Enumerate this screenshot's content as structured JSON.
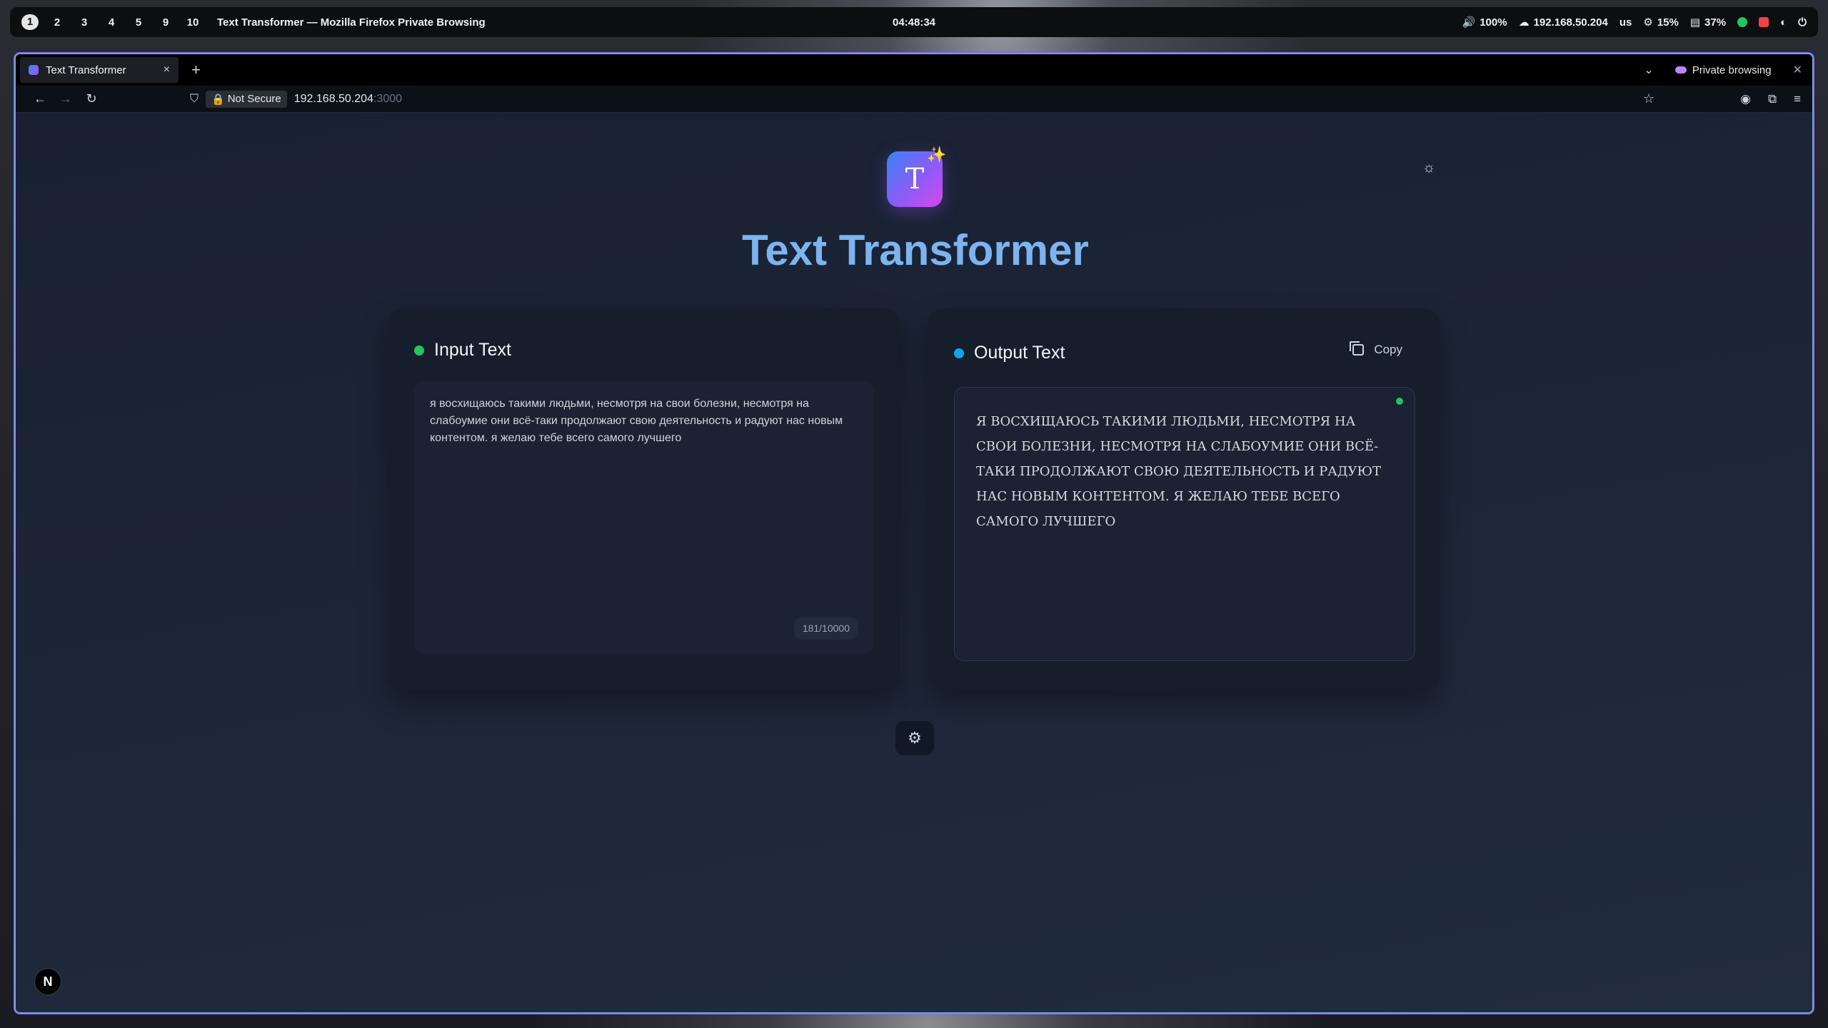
{
  "system_bar": {
    "workspaces": [
      "1",
      "2",
      "3",
      "4",
      "5",
      "9",
      "10"
    ],
    "active_workspace": "1",
    "window_title": "Text Transformer — Mozilla Firefox Private Browsing",
    "clock": "04:48:34",
    "volume": "100%",
    "network": "192.168.50.204",
    "keyboard_layout": "us",
    "cpu": "15%",
    "memory": "37%"
  },
  "browser": {
    "tab_title": "Text Transformer",
    "tab_close": "×",
    "new_tab": "+",
    "private_label": "Private browsing",
    "not_secure_label": "Not Secure",
    "url_host": "192.168.50.204",
    "url_port": ":3000"
  },
  "app": {
    "logo_letter": "T",
    "title": "Text Transformer",
    "input": {
      "title": "Input Text",
      "text": "я восхищаюсь такими людьми, несмотря на свои болезни, несмотря на слабоумие они всё-таки продолжают свою деятельность и радуют нас новым контентом. я желаю тебе всего самого лучшего",
      "char_count": "181/10000"
    },
    "output": {
      "title": "Output Text",
      "copy_label": "Copy",
      "text": "Я ВОСХИЩАЮСЬ ТАКИМИ ЛЮДЬМИ, НЕСМОТРЯ НА СВОИ ƂОЛЕЗНИ, НЕСМОТРЯ НА СЛАƂОУМИЕ ОНИ ВСЁ-ТАКИ ПРОДОЛЖАЮТ СВОЮ ДЕЯТЕЛЬНОСТЬ И РАДУЮТ НАС НОВЫМ КОНТЕНТОМ. Я ЖЕЛАЮ ТЕƂЕ ВСЕГО САМОГО ЛУЧШЕГО"
    },
    "next_badge": "N"
  },
  "colors": {
    "input_dot": "#22c55e",
    "output_dot": "#0ea5e9",
    "title": "#7cb4f0"
  }
}
